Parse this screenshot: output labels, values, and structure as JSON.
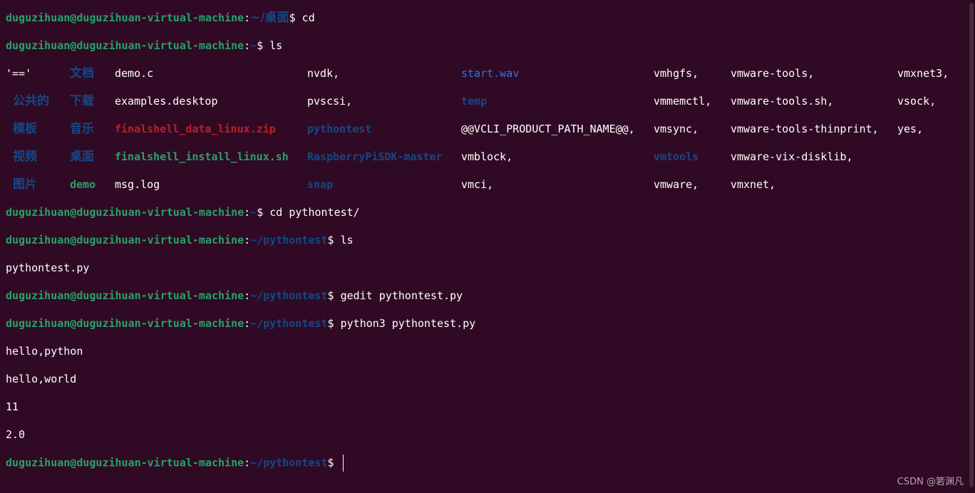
{
  "prompt": {
    "user": "duguzihuan@duguzihuan-virtual-machine",
    "colon": ":",
    "dollar": "$"
  },
  "lines": [
    {
      "type": "prompt",
      "path": "~/桌面",
      "cmd": " cd"
    },
    {
      "type": "prompt",
      "path": "~",
      "cmd": " ls"
    },
    {
      "type": "prompt",
      "path": "~",
      "cmd": " cd pythontest/"
    },
    {
      "type": "prompt",
      "path": "~/pythontest",
      "cmd": " ls"
    },
    {
      "type": "output",
      "text": "pythontest.py"
    },
    {
      "type": "prompt",
      "path": "~/pythontest",
      "cmd": " gedit pythontest.py"
    },
    {
      "type": "prompt",
      "path": "~/pythontest",
      "cmd": " python3 pythontest.py"
    },
    {
      "type": "output",
      "text": "hello,python"
    },
    {
      "type": "output",
      "text": "hello,world"
    },
    {
      "type": "output",
      "text": "11"
    },
    {
      "type": "output",
      "text": "2.0"
    },
    {
      "type": "prompt",
      "path": "~/pythontest",
      "cmd": ""
    }
  ],
  "ls_listing": [
    [
      "'=='",
      "文档",
      "demo.c",
      "nvdk,",
      "start.wav",
      "vmhgfs,",
      "vmware-tools,",
      "vmxnet3,"
    ],
    [
      "公共的",
      "下载",
      "examples.desktop",
      "pvscsi,",
      "temp",
      "vmmemctl,",
      "vmware-tools.sh,",
      "vsock,"
    ],
    [
      "模板",
      "音乐",
      "finalshell_data_linux.zip",
      "pythontest",
      "@@VCLI_PRODUCT_PATH_NAME@@,",
      "vmsync,",
      "vmware-tools-thinprint,",
      "yes,"
    ],
    [
      "视频",
      "桌面",
      "finalshell_install_linux.sh",
      "RaspberryPiSDK-master",
      "vmblock,",
      "vmtools",
      "vmware-vix-disklib,",
      ""
    ],
    [
      "图片",
      "demo",
      "msg.log",
      "snap",
      "vmci,",
      "vmware,",
      "vmxnet,",
      ""
    ]
  ],
  "ls_styles": [
    [
      "plain",
      "dir",
      "plain",
      "plain",
      "media",
      "plain",
      "plain",
      "plain"
    ],
    [
      "dir",
      "dir",
      "plain",
      "plain",
      "dir",
      "plain",
      "plain",
      "plain"
    ],
    [
      "dir",
      "dir",
      "arch",
      "dir",
      "plain",
      "plain",
      "plain",
      "plain"
    ],
    [
      "dir",
      "dir",
      "exec",
      "dir",
      "plain",
      "dir",
      "plain",
      "plain"
    ],
    [
      "dir",
      "dirgreen",
      "plain",
      "dir",
      "plain",
      "plain",
      "plain",
      "plain"
    ]
  ],
  "colors": {
    "background": "#300a24",
    "user": "#26a269",
    "directory": "#12488b",
    "archive": "#c01c28",
    "media": "#2a7bde",
    "text": "#ffffff"
  },
  "watermark": "CSDN @箬渊凡"
}
